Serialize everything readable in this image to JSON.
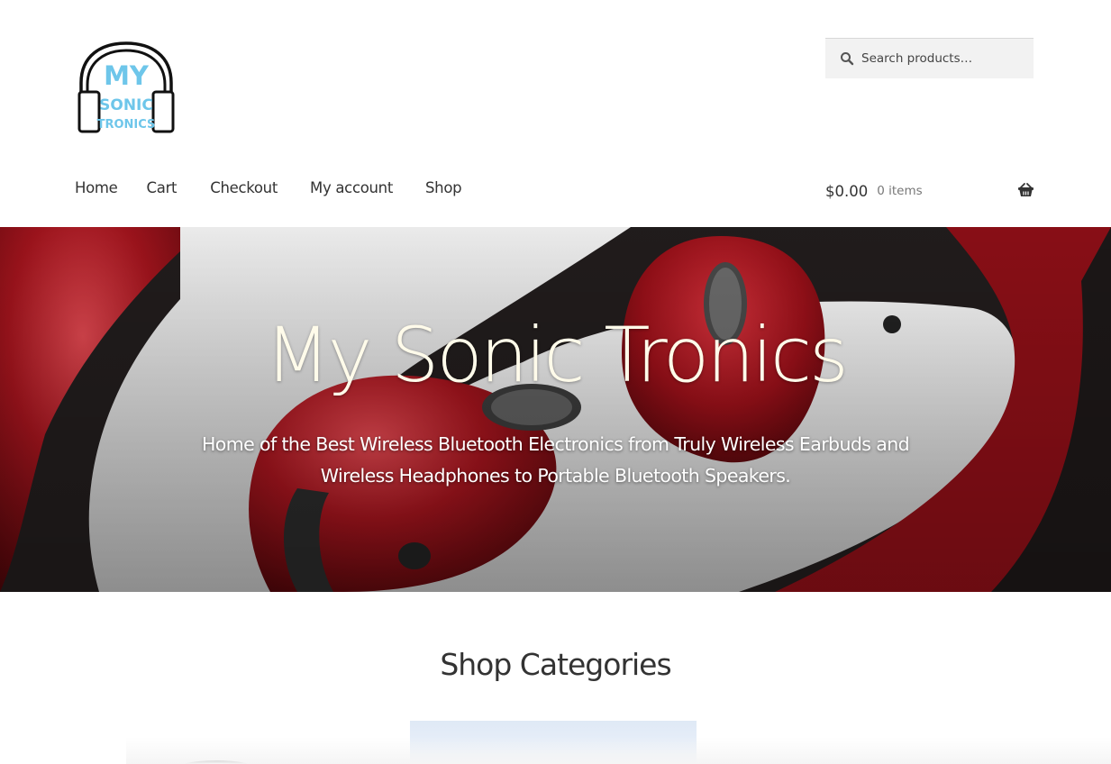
{
  "site": {
    "logo_text": [
      "MY",
      "SONIC",
      "TRONICS"
    ],
    "search_placeholder": "Search products…"
  },
  "nav": {
    "items": [
      {
        "label": "Home"
      },
      {
        "label": "Cart"
      },
      {
        "label": "Checkout"
      },
      {
        "label": "My account"
      },
      {
        "label": "Shop"
      }
    ]
  },
  "cart": {
    "amount": "$0.00",
    "count": "0 items"
  },
  "hero": {
    "title": "My Sonic Tronics",
    "subtitle": "Home of the Best Wireless Bluetooth Electronics from Truly Wireless Earbuds and Wireless Headphones to Portable Bluetooth Speakers."
  },
  "section": {
    "title": "Shop Categories"
  },
  "colors": {
    "logo_accent": "#6ec6ea",
    "hero_title": "#fffbea",
    "earbud_red": "#a3141d"
  }
}
